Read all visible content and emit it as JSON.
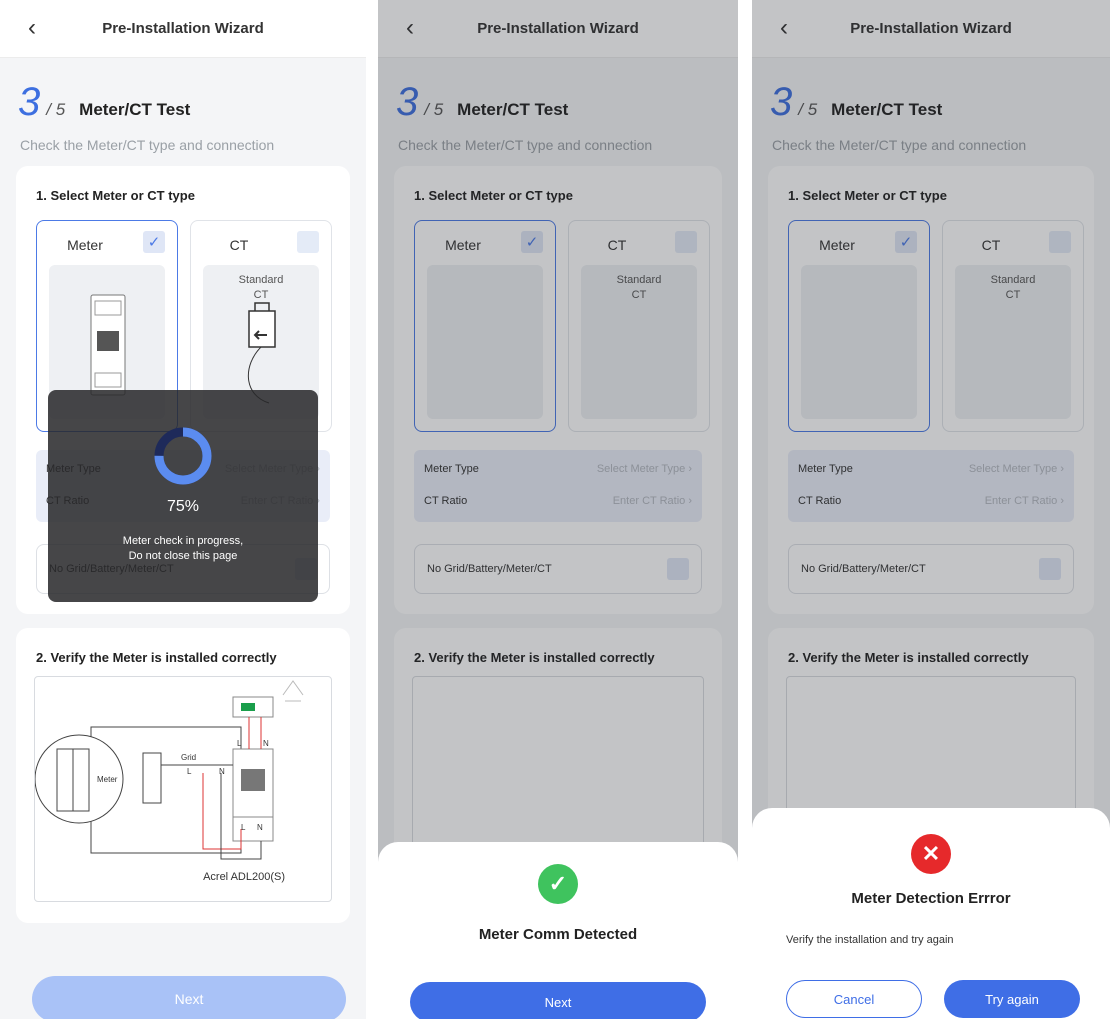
{
  "header": {
    "back_icon": "‹",
    "title": "Pre-Installation Wizard"
  },
  "step": {
    "current": "3",
    "total": "/ 5",
    "name": "Meter/CT Test",
    "subtitle": "Check the Meter/CT type and connection"
  },
  "section1": {
    "title": "1. Select Meter or CT type",
    "meter_label": "Meter",
    "ct_label": "CT",
    "ct_caption_1": "Standard",
    "ct_caption_2": "CT",
    "meter_type_label": "Meter Type",
    "meter_type_value": "Select Meter Type",
    "ct_ratio_label": "CT Ratio",
    "ct_ratio_value": "Enter CT Ratio",
    "chevron": "›",
    "no_grid_label": "No Grid/Battery/Meter/CT"
  },
  "section2": {
    "title": "2. Verify the Meter is installed correctly",
    "diagram_meter": "Meter",
    "diagram_grid": "Grid",
    "diagram_L": "L",
    "diagram_N": "N",
    "model": "Acrel ADL200(S)"
  },
  "next_label": "Next",
  "loading": {
    "percent_text": "75%",
    "progress": 0.75,
    "line1": "Meter check in progress,",
    "line2": "Do not  close this page"
  },
  "success": {
    "title": "Meter Comm Detected",
    "button": "Next"
  },
  "error": {
    "title": "Meter Detection Errror",
    "body": "Verify the installation and try again",
    "cancel": "Cancel",
    "retry": "Try again"
  },
  "colors": {
    "accent": "#3f6ee6",
    "success": "#3fc35e",
    "error": "#e6292b"
  }
}
